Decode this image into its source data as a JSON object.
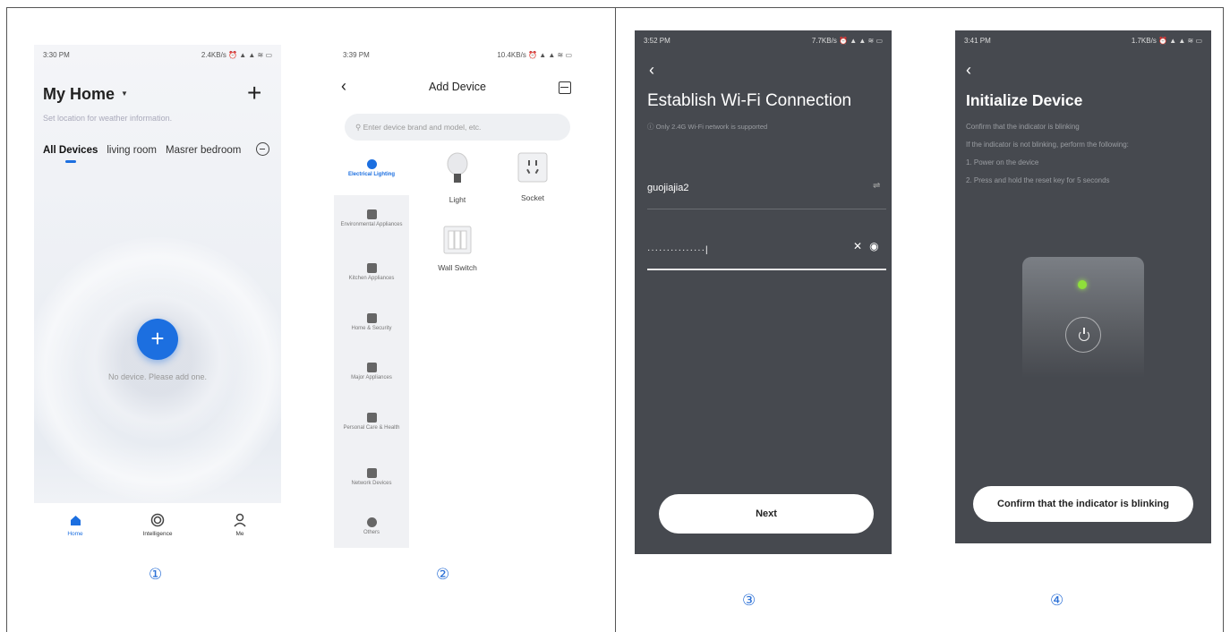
{
  "screen1": {
    "status_time": "3:30 PM",
    "status_right": "2.4KB/s ⏰ ▲ ▲ ≋ ▭",
    "home_title": "My Home",
    "add_icon": "plus-icon",
    "subtitle": "Set location for weather information.",
    "tabs": [
      "All Devices",
      "living room",
      "Masrer bedroom"
    ],
    "empty_message": "No device. Please add one.",
    "nav": [
      {
        "label": "Home",
        "icon": "home-icon"
      },
      {
        "label": "Intelligence",
        "icon": "intelligence-icon"
      },
      {
        "label": "Me",
        "icon": "user-icon"
      }
    ],
    "step": "①"
  },
  "screen2": {
    "status_time": "3:39 PM",
    "status_right": "10.4KB/s ⏰ ▲ ▲ ≋ ▭",
    "title": "Add Device",
    "search_placeholder": "Enter device brand and model, etc.",
    "categories": [
      "Electrical Lighting",
      "Environmental Appliances",
      "Kitchen Appliances",
      "Home & Security",
      "Major Appliances",
      "Personal Care & Health",
      "Network Devices",
      "Others"
    ],
    "devices": [
      "Light",
      "Socket",
      "Wall Switch"
    ],
    "step": "②"
  },
  "screen3": {
    "status_time": "3:52 PM",
    "status_right": "7.7KB/s ⏰ ▲ ▲ ≋ ▭",
    "title": "Establish Wi-Fi Connection",
    "subtitle": "Only 2.4G Wi-Fi network is supported",
    "ssid": "guojiajia2",
    "password_mask": "···············|",
    "next_label": "Next",
    "step": "③"
  },
  "screen4": {
    "status_time": "3:41 PM",
    "status_right": "1.7KB/s ⏰ ▲ ▲ ≋ ▭",
    "title": "Initialize Device",
    "lines": [
      "Confirm that the indicator is blinking",
      "If the indicator is not blinking, perform the following:",
      "1. Power on the device",
      "2. Press and hold the reset key for 5 seconds"
    ],
    "confirm_label": "Confirm that the indicator is blinking",
    "step": "④"
  },
  "colors": {
    "accent": "#1c6fe0",
    "dark_bg": "#46494f",
    "led": "#8fe03a"
  }
}
